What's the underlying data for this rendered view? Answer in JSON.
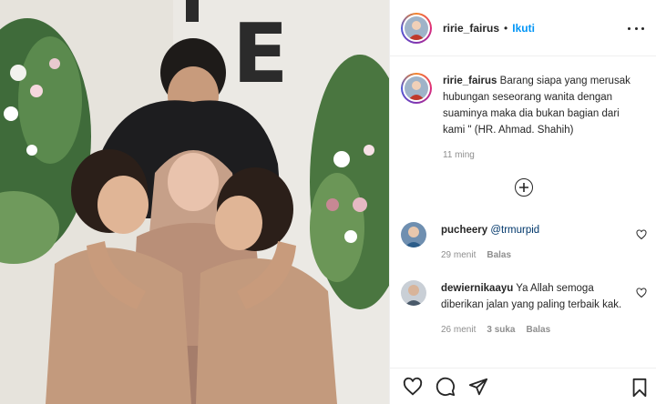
{
  "post": {
    "username": "ririe_fairus",
    "separator": "•",
    "follow_label": "Ikuti",
    "caption_username": "ririe_fairus",
    "caption_text": "Barang siapa yang merusak hubungan seseorang wanita dengan suaminya maka dia bukan bagian dari kami \" (HR. Ahmad. Shahih)",
    "time": "11 ming",
    "backdrop_letters": "E"
  },
  "comments": [
    {
      "username": "pucheery",
      "mention": "@trmurpid",
      "text": "",
      "time": "29 menit",
      "likes": "",
      "reply_label": "Balas"
    },
    {
      "username": "dewiernikaayu",
      "mention": "",
      "text": "Ya Allah semoga diberikan jalan yang paling terbaik kak.",
      "time": "26 menit",
      "likes": "3 suka",
      "reply_label": "Balas"
    }
  ],
  "icons": {
    "more": "more-options-icon",
    "load_more": "plus-circle-icon",
    "like": "heart-icon",
    "comment": "comment-bubble-icon",
    "share": "paper-plane-icon",
    "save": "bookmark-icon"
  },
  "colors": {
    "follow": "#0095f6",
    "secondary": "#8e8e8e",
    "mention": "#00376b"
  }
}
